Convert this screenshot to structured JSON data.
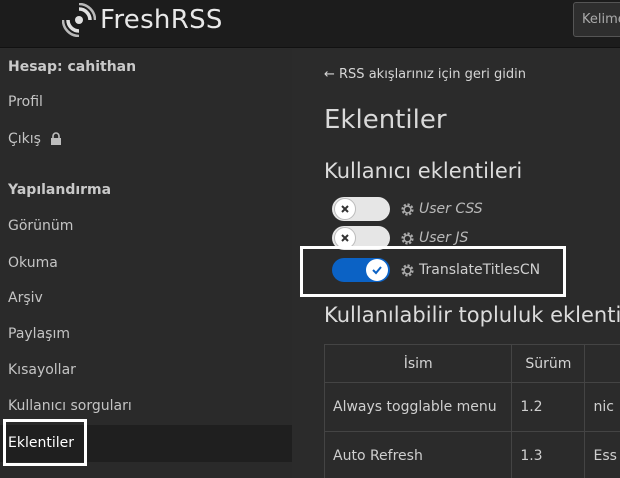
{
  "app": {
    "title": "FreshRSS",
    "search_placeholder": "Kelimeler"
  },
  "sidebar": {
    "account_heading": "Hesap: cahithan",
    "account_items": [
      {
        "label": "Profil"
      },
      {
        "label": "Çıkış"
      }
    ],
    "config_heading": "Yapılandırma",
    "config_items": [
      {
        "label": "Görünüm"
      },
      {
        "label": "Okuma"
      },
      {
        "label": "Arşiv"
      },
      {
        "label": "Paylaşım"
      },
      {
        "label": "Kısayollar"
      },
      {
        "label": "Kullanıcı sorguları"
      },
      {
        "label": "Eklentiler",
        "active": true
      }
    ]
  },
  "main": {
    "back_link": "← RSS akışlarınız için geri gidin",
    "title": "Eklentiler",
    "user_extensions_heading": "Kullanıcı eklentileri",
    "user_extensions": [
      {
        "name": "User CSS",
        "enabled": false
      },
      {
        "name": "User JS",
        "enabled": false
      },
      {
        "name": "TranslateTitlesCN",
        "enabled": true
      }
    ],
    "community_heading": "Kullanılabilir topluluk eklentileri",
    "table": {
      "headers": [
        "İsim",
        "Sürüm",
        ""
      ],
      "rows": [
        {
          "name": "Always togglable menu",
          "version": "1.2",
          "extra": "nic"
        },
        {
          "name": "Auto Refresh",
          "version": "1.3",
          "extra": "Ess"
        }
      ]
    }
  },
  "colors": {
    "header_bg": "#1c1c1c",
    "sidebar_bg": "#2a2a2a",
    "main_bg": "#2b2b2b",
    "toggle_on": "#0b62c5",
    "toggle_off": "#e6e6e6"
  }
}
